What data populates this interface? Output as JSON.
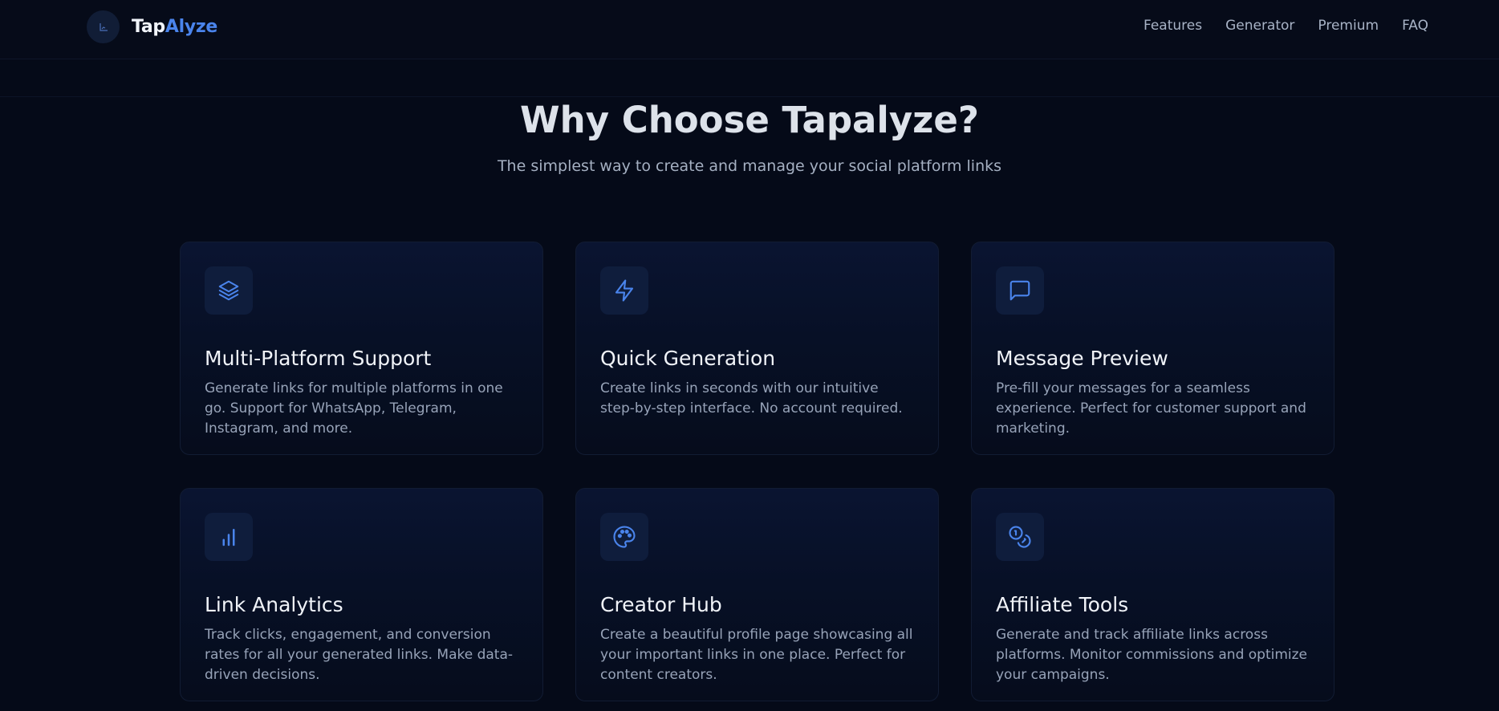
{
  "header": {
    "logo_part1": "Tap",
    "logo_part2": "Alyze",
    "nav": [
      "Features",
      "Generator",
      "Premium",
      "FAQ"
    ]
  },
  "hero": {
    "title": "Why Choose Tapalyze?",
    "subtitle": "The simplest way to create and manage your social platform links"
  },
  "features": [
    {
      "icon": "layers-icon",
      "title": "Multi-Platform Support",
      "description": "Generate links for multiple platforms in one go. Support for WhatsApp, Telegram, Instagram, and more."
    },
    {
      "icon": "lightning-icon",
      "title": "Quick Generation",
      "description": "Create links in seconds with our intuitive step-by-step interface. No account required."
    },
    {
      "icon": "message-icon",
      "title": "Message Preview",
      "description": "Pre-fill your messages for a seamless experience. Perfect for customer support and marketing."
    },
    {
      "icon": "bar-chart-icon",
      "title": "Link Analytics",
      "description": "Track clicks, engagement, and conversion rates for all your generated links. Make data-driven decisions."
    },
    {
      "icon": "palette-icon",
      "title": "Creator Hub",
      "description": "Create a beautiful profile page showcasing all your important links in one place. Perfect for content creators."
    },
    {
      "icon": "coins-icon",
      "title": "Affiliate Tools",
      "description": "Generate and track affiliate links across platforms. Monitor commissions and optimize your campaigns."
    }
  ],
  "colors": {
    "background": "#050a18",
    "accent": "#4a84ec",
    "card_border": "#121c33"
  }
}
